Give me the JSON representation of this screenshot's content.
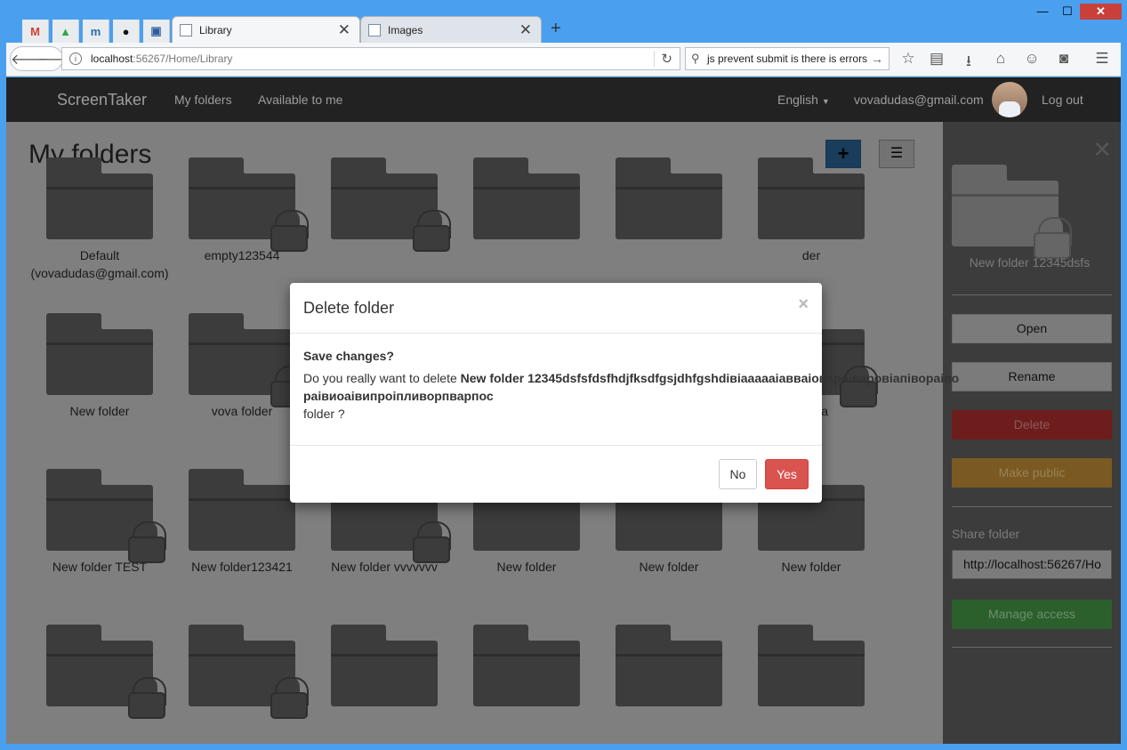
{
  "window": {
    "minimize": "—",
    "maximize": "☐",
    "close": "✕"
  },
  "tabs": [
    {
      "label": "Library",
      "active": true
    },
    {
      "label": "Images",
      "active": false
    }
  ],
  "pinned_tabs": [
    "gmail-icon",
    "drive-icon",
    "m-app-icon",
    "github-icon",
    "chat-icon"
  ],
  "addressbar": {
    "host": "localhost",
    "path": ":56267/Home/Library"
  },
  "searchbar": {
    "value": "js prevent submit is there is errors"
  },
  "site": {
    "brand": "ScreenTaker",
    "nav_my_folders": "My folders",
    "nav_available": "Available to me",
    "language": "English",
    "email": "vovadudas@gmail.com",
    "logout": "Log out"
  },
  "main": {
    "title": "My folders",
    "add_button": "+",
    "list_button": "☰"
  },
  "folders": [
    {
      "label": "Default (vovadudas@gmail.com)",
      "locked": false
    },
    {
      "label": "empty123544",
      "locked": true
    },
    {
      "label": "",
      "locked": true
    },
    {
      "label": "",
      "locked": false
    },
    {
      "label": "",
      "locked": false
    },
    {
      "label": "der",
      "locked": false
    },
    {
      "label": "New folder",
      "locked": false
    },
    {
      "label": "vova folder",
      "locked": true
    },
    {
      "label": "r vova",
      "locked": true
    },
    {
      "label": "New folder TEST",
      "locked": true
    },
    {
      "label": "New folder123421",
      "locked": false
    },
    {
      "label": "New folder vvvvvvv",
      "locked": true
    },
    {
      "label": "New folder",
      "locked": false
    },
    {
      "label": "New folder",
      "locked": false
    },
    {
      "label": "New folder",
      "locked": false
    }
  ],
  "panel": {
    "close": "✕",
    "folder_name": "New folder 12345dsfs",
    "open": "Open",
    "rename": "Rename",
    "delete": "Delete",
    "make_public": "Make public",
    "share_label": "Share folder",
    "share_value": "http://localhost:56267/Ho",
    "manage_access": "Manage access"
  },
  "modal": {
    "title": "Delete folder",
    "close": "×",
    "question": "Save changes?",
    "text_prefix": "Do you really want to delete ",
    "folder_name": "New folder 12345dsfsfdsfhdjfksdfgsjdhfgshdiвіaaaaaіаввaіовароіваровіапіворaіворaівиоaівипроіпливорпварпос",
    "text_suffix": "folder ?",
    "no": "No",
    "yes": "Yes"
  },
  "colors": {
    "navbar": "#222222",
    "primary": "#337ab7",
    "danger": "#d9534f",
    "panel": "#3c3c3c"
  }
}
